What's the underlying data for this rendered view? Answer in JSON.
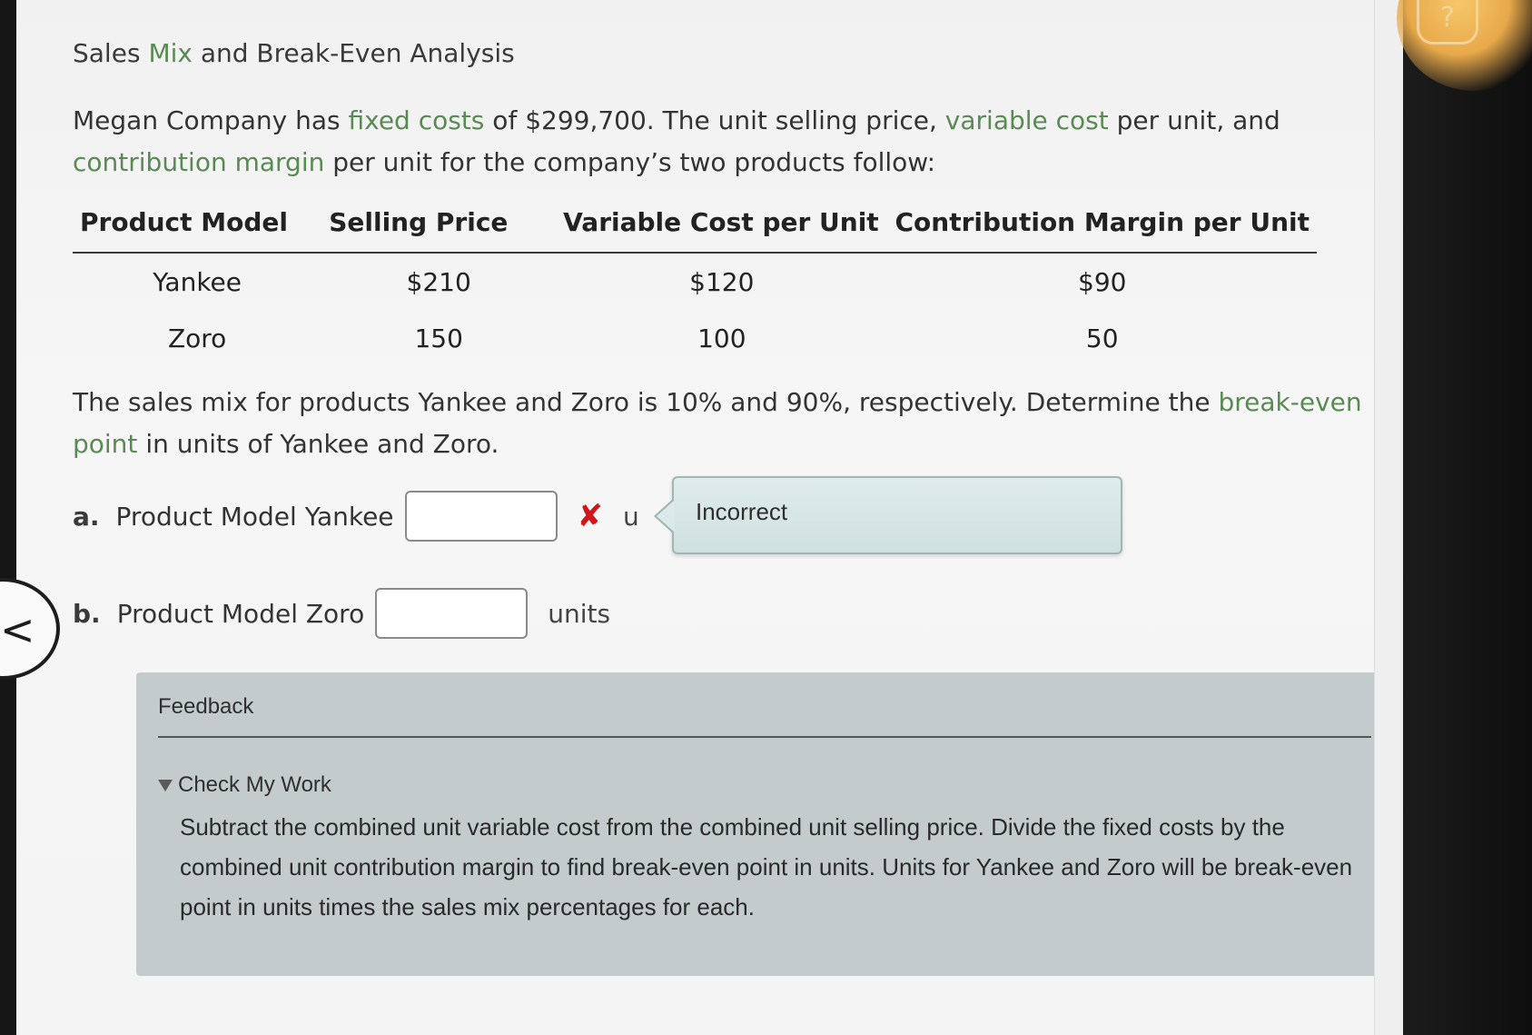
{
  "help_button": {
    "label": "?"
  },
  "title": {
    "part1": "Sales ",
    "kw": "Mix",
    "part2": " and Break-Even Analysis"
  },
  "intro": {
    "t1": "Megan Company has ",
    "kw1": "fixed costs",
    "t2": " of $299,700. The unit selling price, ",
    "kw2": "variable cost",
    "t3": " per unit, and ",
    "kw3": "contribution margin",
    "t4": " per unit for the company’s two products follow:"
  },
  "table": {
    "headers": [
      "Product Model",
      "Selling Price",
      "Variable Cost per Unit",
      "Contribution Margin per Unit"
    ],
    "rows": [
      [
        "Yankee",
        "$210",
        "$120",
        "$90"
      ],
      [
        "Zoro",
        "150",
        "100",
        "50"
      ]
    ]
  },
  "instructions": {
    "t1": "The sales mix for products Yankee and Zoro is 10% and 90%, respectively. Determine the ",
    "kw": "break-even point",
    "t2": " in units of Yankee and Zoro."
  },
  "questions": {
    "a": {
      "letter": "a.",
      "label": "Product Model Yankee",
      "value": "",
      "status_mark": "✘",
      "units_partial": "u"
    },
    "b": {
      "letter": "b.",
      "label": "Product Model Zoro",
      "value": "",
      "units": "units"
    }
  },
  "tooltip": {
    "text": "Incorrect"
  },
  "nav": {
    "prev_glyph": "<"
  },
  "feedback": {
    "title": "Feedback",
    "toggle_label": "Check My Work",
    "body": "Subtract the combined unit variable cost from the combined unit selling price. Divide the fixed costs by the combined unit contribution margin to find break-even point in units. Units for Yankee and Zoro will be break-even point in units times the sales mix percentages for each."
  },
  "colors": {
    "keyword_green": "#5a8a54",
    "error_red": "#d0161b",
    "tooltip_bg": "#d6e6e4",
    "feedback_bg": "#c4cbcd"
  }
}
